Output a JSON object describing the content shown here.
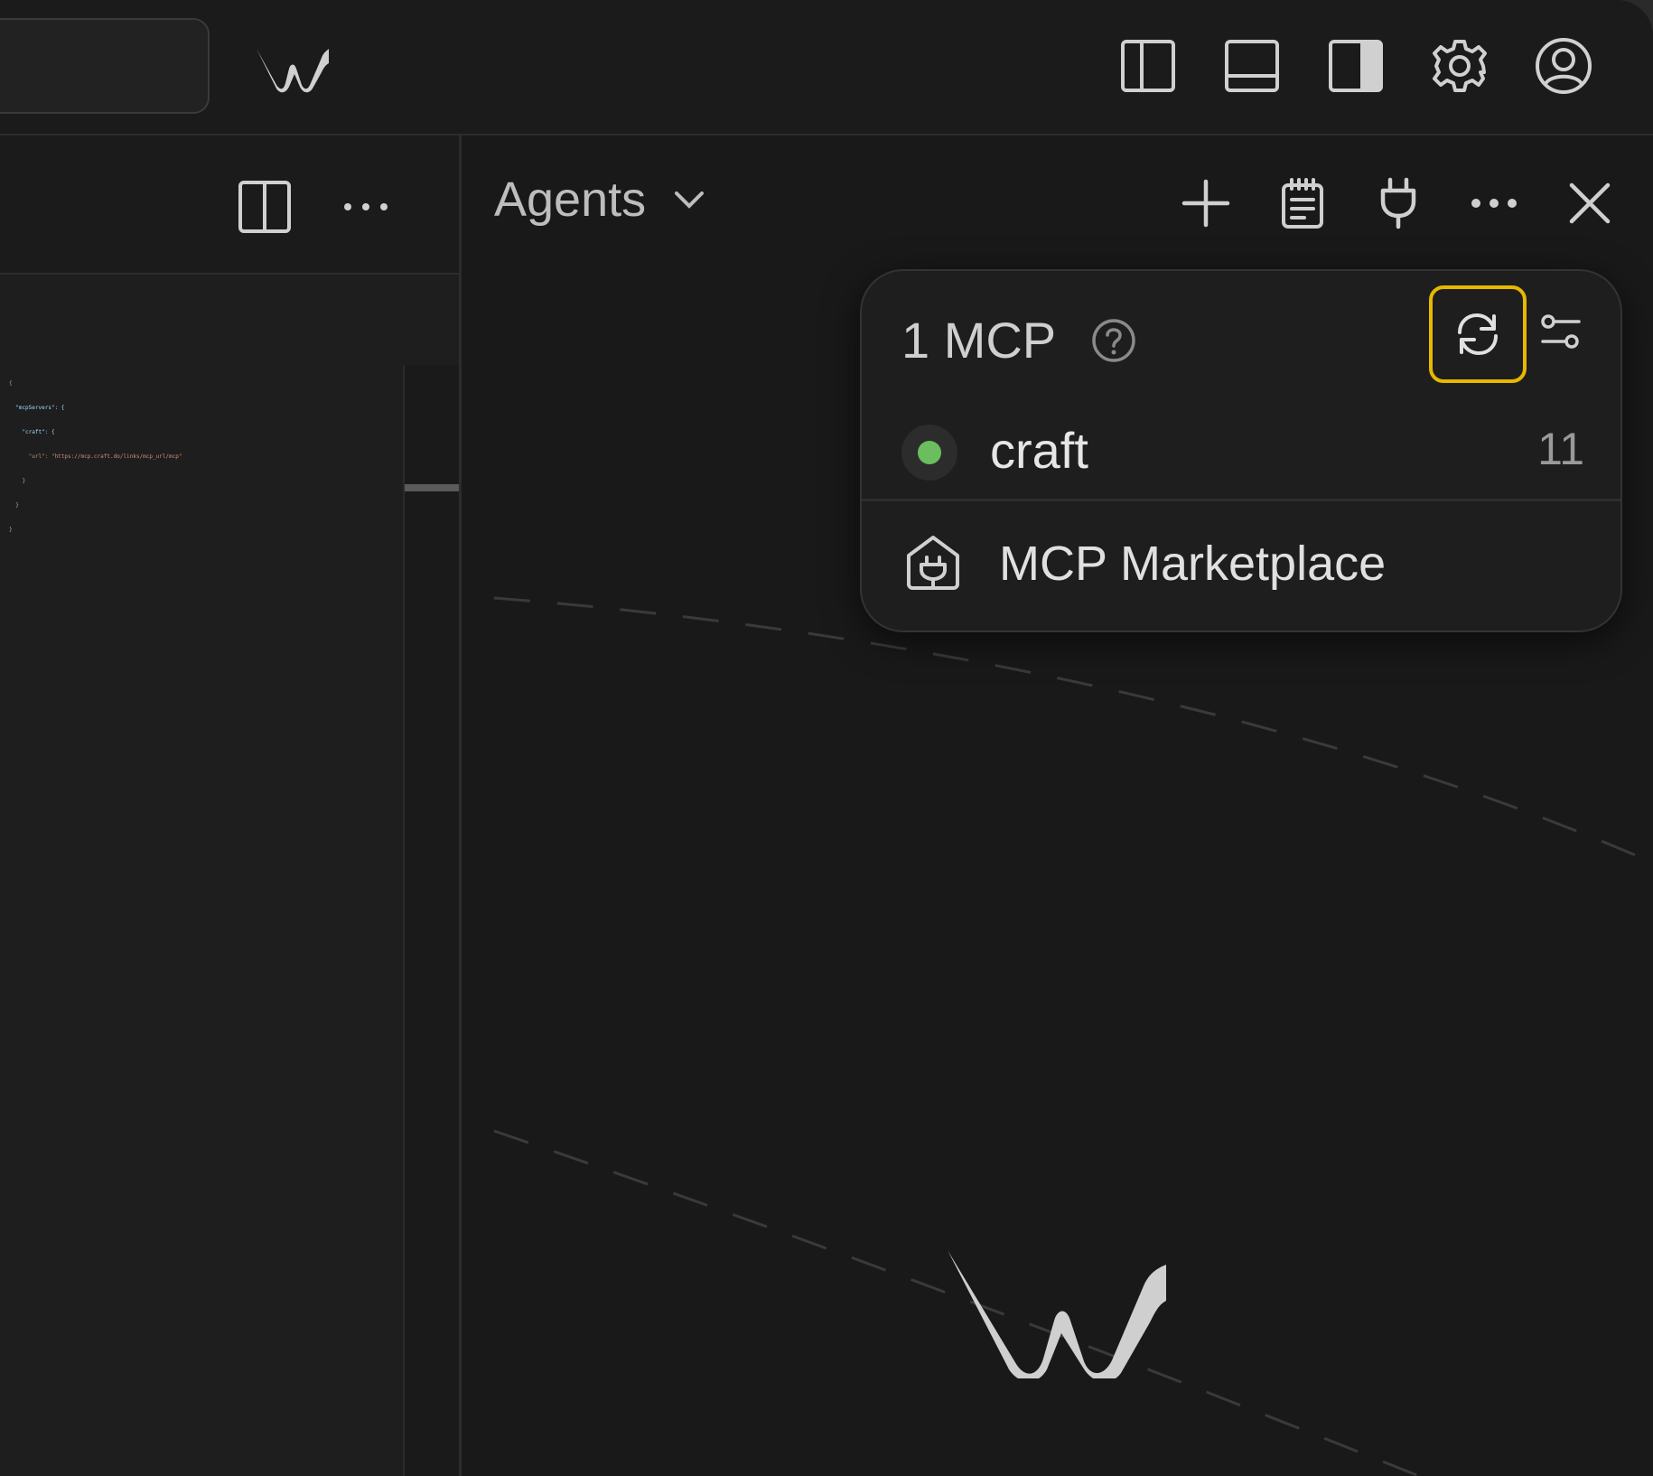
{
  "panel": {
    "title": "Agents"
  },
  "mcp_popup": {
    "title": "1 MCP",
    "servers": [
      {
        "name": "craft",
        "count": "11",
        "status_color": "#6abe5d"
      }
    ],
    "marketplace_label": "MCP Marketplace",
    "highlight_color": "#e6b800"
  },
  "editor": {
    "code_lines": [
      "{",
      "  \"mcpServers\": {",
      "    \"craft\": {",
      "      \"url\": \"https://mcp.craft.do/links/mcp_url/mcp\"",
      "    }",
      "  }",
      "}"
    ]
  },
  "icons": {
    "top_bar": [
      "toggle-left-sidebar-icon",
      "toggle-bottom-panel-icon",
      "toggle-right-sidebar-icon",
      "gear-icon",
      "account-icon"
    ],
    "left_header": [
      "split-editor-icon",
      "more-icon"
    ],
    "agents_header": [
      "plus-icon",
      "clipboard-icon",
      "plug-icon",
      "more-icon",
      "close-icon"
    ]
  }
}
